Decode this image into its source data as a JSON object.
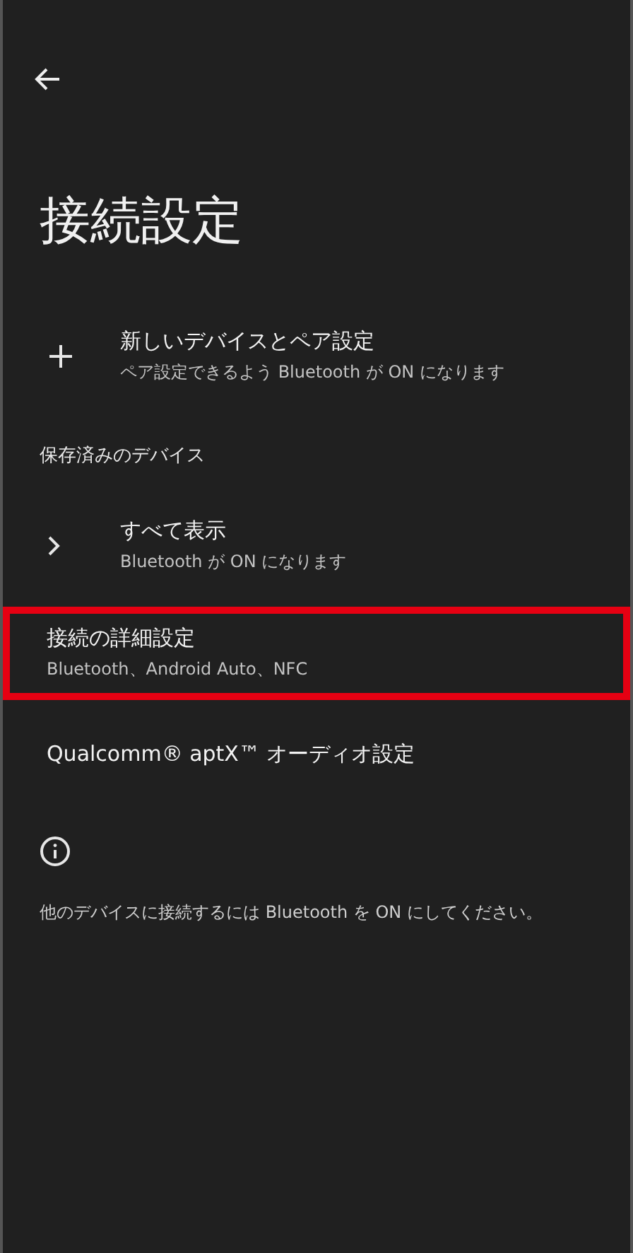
{
  "title": "接続設定",
  "rows": [
    {
      "kind": "plus",
      "title": "新しいデバイスとペア設定",
      "subtitle": "ペア設定できるよう Bluetooth が ON になります",
      "highlighted": false
    },
    {
      "kind": "header",
      "title": "保存済みのデバイス"
    },
    {
      "kind": "chevron",
      "title": "すべて表示",
      "subtitle": "Bluetooth が ON になります",
      "highlighted": false
    },
    {
      "kind": "plain",
      "title": "接続の詳細設定",
      "subtitle": "Bluetooth、Android Auto、NFC",
      "highlighted": true
    },
    {
      "kind": "plain",
      "title": "Qualcomm® aptX™ オーディオ設定",
      "highlighted": false
    }
  ],
  "info": {
    "text": "他のデバイスに接続するには Bluetooth を ON にしてください。"
  }
}
